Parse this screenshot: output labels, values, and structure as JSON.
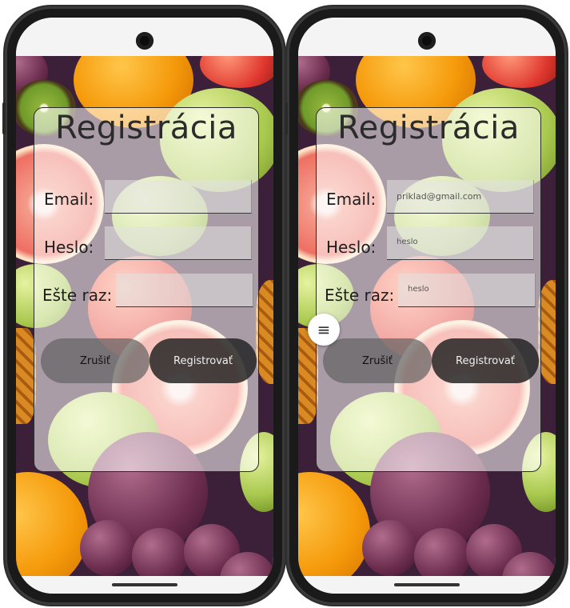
{
  "screens": [
    {
      "title": "Registrácia",
      "email_label": "Email:",
      "password_label": "Heslo:",
      "repeat_label": "Ešte raz:",
      "email_value": "",
      "password_value": "",
      "repeat_value": "",
      "cancel_label": "Zrušiť",
      "register_label": "Registrovať"
    },
    {
      "title": "Registrácia",
      "email_label": "Email:",
      "password_label": "Heslo:",
      "repeat_label": "Ešte raz:",
      "email_value": "priklad@gmail.com",
      "password_value": "heslo",
      "repeat_value": "heslo",
      "cancel_label": "Zrušiť",
      "register_label": "Registrovať",
      "menu_icon": "≡"
    }
  ],
  "colors": {
    "card_bg": "rgba(255,255,255,0.56)",
    "cancel_button": "#646464",
    "register_button": "#232323"
  }
}
